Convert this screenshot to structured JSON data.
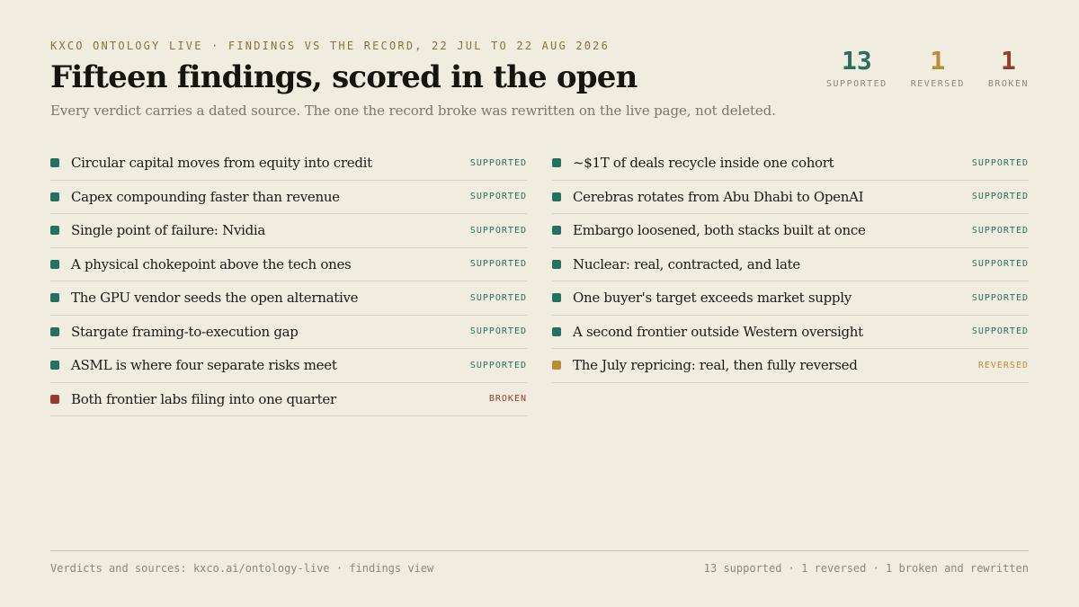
{
  "header": {
    "eyebrow": "KXCO ONTOLOGY LIVE · FINDINGS VS THE RECORD, 22 JUL TO 22 AUG 2026",
    "title": "Fifteen findings, scored in the open",
    "subtitle": "Every verdict carries a dated source. The one the record broke was rewritten on the live page, not deleted."
  },
  "colors": {
    "supported": "#27705f",
    "reversed": "#b98d34",
    "broken": "#9a3a2e"
  },
  "stats": [
    {
      "value": "13",
      "label": "SUPPORTED",
      "kind": "supported"
    },
    {
      "value": "1",
      "label": "REVERSED",
      "kind": "reversed"
    },
    {
      "value": "1",
      "label": "BROKEN",
      "kind": "broken"
    }
  ],
  "findings_left": [
    {
      "text": "Circular capital moves from equity into credit",
      "status": "SUPPORTED",
      "kind": "supported"
    },
    {
      "text": "Capex compounding faster than revenue",
      "status": "SUPPORTED",
      "kind": "supported"
    },
    {
      "text": "Single point of failure: Nvidia",
      "status": "SUPPORTED",
      "kind": "supported"
    },
    {
      "text": "A physical chokepoint above the tech ones",
      "status": "SUPPORTED",
      "kind": "supported"
    },
    {
      "text": "The GPU vendor seeds the open alternative",
      "status": "SUPPORTED",
      "kind": "supported"
    },
    {
      "text": "Stargate framing-to-execution gap",
      "status": "SUPPORTED",
      "kind": "supported"
    },
    {
      "text": "ASML is where four separate risks meet",
      "status": "SUPPORTED",
      "kind": "supported"
    },
    {
      "text": "Both frontier labs filing into one quarter",
      "status": "BROKEN",
      "kind": "broken"
    }
  ],
  "findings_right": [
    {
      "text": "~$1T of deals recycle inside one cohort",
      "status": "SUPPORTED",
      "kind": "supported"
    },
    {
      "text": "Cerebras rotates from Abu Dhabi to OpenAI",
      "status": "SUPPORTED",
      "kind": "supported"
    },
    {
      "text": "Embargo loosened, both stacks built at once",
      "status": "SUPPORTED",
      "kind": "supported"
    },
    {
      "text": "Nuclear: real, contracted, and late",
      "status": "SUPPORTED",
      "kind": "supported"
    },
    {
      "text": "One buyer's target exceeds market supply",
      "status": "SUPPORTED",
      "kind": "supported"
    },
    {
      "text": "A second frontier outside Western oversight",
      "status": "SUPPORTED",
      "kind": "supported"
    },
    {
      "text": "The July repricing: real, then fully reversed",
      "status": "REVERSED",
      "kind": "reversed"
    }
  ],
  "footer": {
    "left": "Verdicts and sources: kxco.ai/ontology-live · findings view",
    "right": "13 supported · 1 reversed · 1 broken and rewritten"
  }
}
